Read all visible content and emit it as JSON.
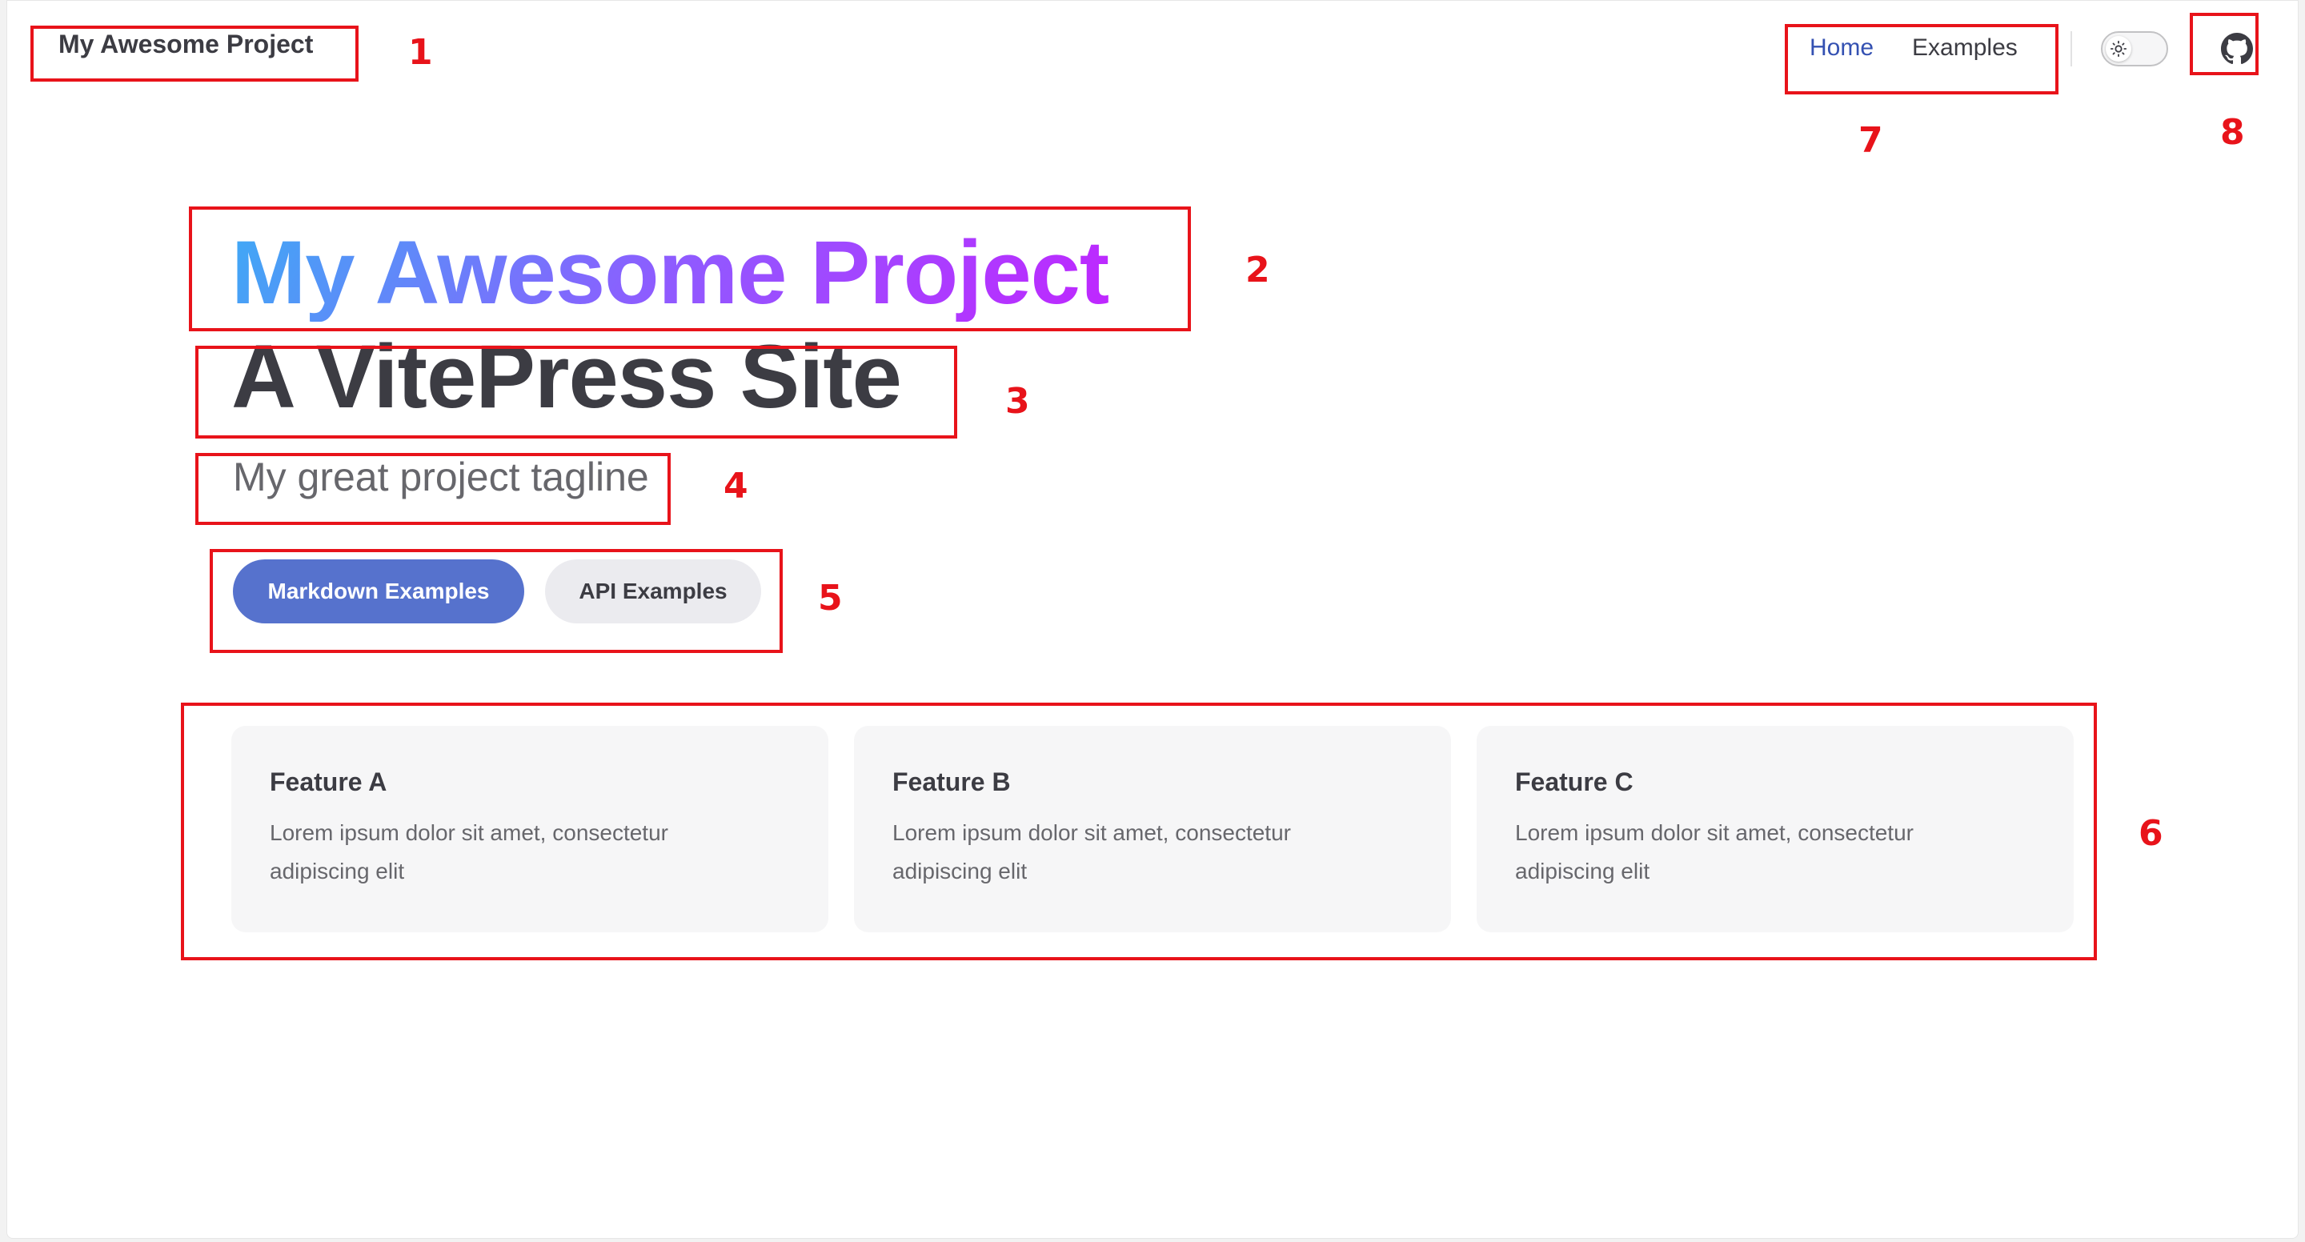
{
  "nav": {
    "site_title": "My Awesome Project",
    "links": [
      {
        "label": "Home",
        "active": true
      },
      {
        "label": "Examples",
        "active": false
      }
    ],
    "theme_toggle_icon": "sun-icon",
    "social_icon": "github-icon"
  },
  "hero": {
    "name": "My Awesome Project",
    "text": "A VitePress Site",
    "tagline": "My great project tagline",
    "actions": [
      {
        "label": "Markdown Examples",
        "theme": "brand"
      },
      {
        "label": "API Examples",
        "theme": "alt"
      }
    ]
  },
  "features": [
    {
      "title": "Feature A",
      "details": "Lorem ipsum dolor sit amet, consectetur adipiscing elit"
    },
    {
      "title": "Feature B",
      "details": "Lorem ipsum dolor sit amet, consectetur adipiscing elit"
    },
    {
      "title": "Feature C",
      "details": "Lorem ipsum dolor sit amet, consectetur adipiscing elit"
    }
  ],
  "annotations": [
    "1",
    "2",
    "3",
    "4",
    "5",
    "6",
    "7",
    "8"
  ],
  "colors": {
    "annotation": "#e8131a",
    "brand": "#5672cd",
    "active_link": "#3451b2",
    "gradient_start": "#3fa9f5",
    "gradient_end": "#c026ff"
  }
}
